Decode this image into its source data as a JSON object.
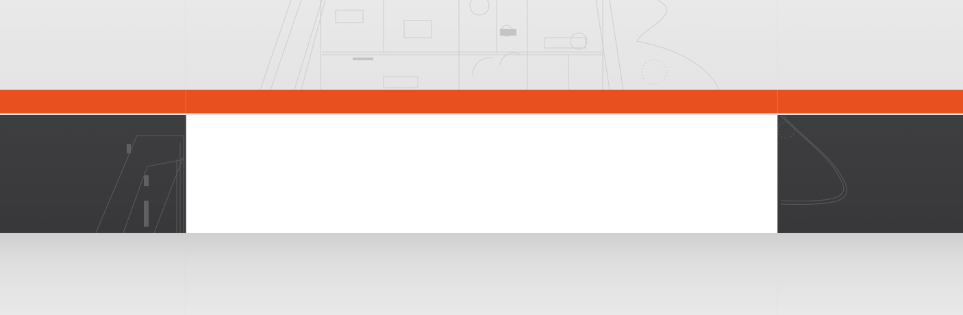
{
  "colors": {
    "accent": "#e8501f",
    "dark_band": "#3c3c3e",
    "panel": "#ffffff",
    "background": "#e6e6e6"
  },
  "background_art": {
    "top": "floor-plan-sketch",
    "dark_left": "floor-plan-sketch",
    "dark_right": "curved-path-sketch"
  },
  "content_panel": {
    "text": ""
  }
}
